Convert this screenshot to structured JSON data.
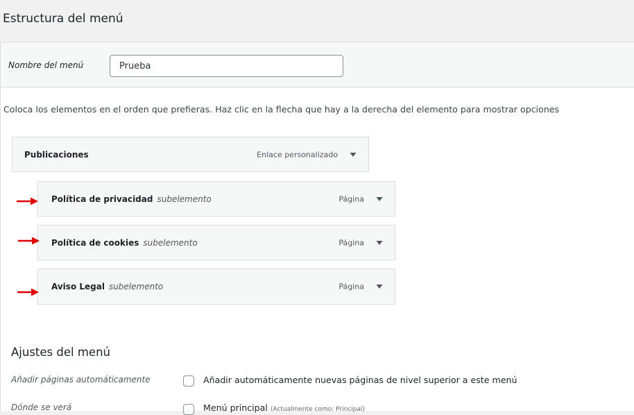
{
  "header": {
    "title": "Estructura del menú"
  },
  "menu_name": {
    "label": "Nombre del menú",
    "value": "Prueba"
  },
  "instructions": "Coloca los elementos en el orden que prefieras. Haz clic en la flecha que hay a la derecha del elemento para mostrar opciones",
  "menu_items": [
    {
      "title": "Publicaciones",
      "subtitle": "",
      "type": "Enlace personalizado",
      "depth": 0
    },
    {
      "title": "Política de privacidad",
      "subtitle": "subelemento",
      "type": "Página",
      "depth": 1
    },
    {
      "title": "Política de cookies",
      "subtitle": "subelemento",
      "type": "Página",
      "depth": 1
    },
    {
      "title": "Aviso Legal",
      "subtitle": "subelemento",
      "type": "Página",
      "depth": 1
    }
  ],
  "settings": {
    "heading": "Ajustes del menú",
    "auto_add": {
      "label": "Añadir páginas automáticamente",
      "checkbox_label": "Añadir automáticamente nuevas páginas de nivel superior a este menú",
      "checked": false
    },
    "location": {
      "label": "Dónde se verá",
      "checkbox_label": "Menú principal",
      "note": "(Actualmente como: Principal)",
      "checked": false
    }
  },
  "colors": {
    "annotation_arrow": "#e00000",
    "panel_background": "#ffffff",
    "page_background": "#f1f1f1",
    "item_background": "#f6f7f7",
    "border": "#dcdcde"
  },
  "icons": {
    "toggle": "triangle-down-icon",
    "annotation": "red-arrow-icon"
  }
}
